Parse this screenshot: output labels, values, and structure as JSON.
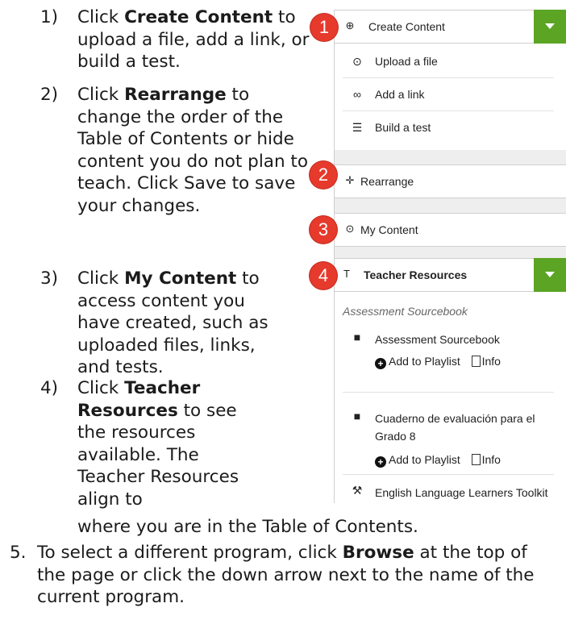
{
  "instructions": {
    "step1": {
      "num": "1)",
      "pre": "Click ",
      "bold": "Create Content",
      "post": " to upload a file, add a link, or build a test."
    },
    "step2": {
      "num": "2)",
      "pre": "Click ",
      "bold": "Rearrange",
      "post": " to change the order of the Table of Contents or hide content you do not plan to teach. Click Save to save your changes."
    },
    "step3": {
      "num": "3)",
      "pre": "Click ",
      "bold": "My Content",
      "post": " to access content you have created, such as uploaded files, links, and tests."
    },
    "step4": {
      "num": "4)",
      "pre": "Click ",
      "bold": "Teacher Resources",
      "post": " to see the resources available. The Teacher Resources align to"
    },
    "step4_cont": "where you are in the Table of Contents.",
    "step5": {
      "num": "5.",
      "pre": "To select a different program, click ",
      "bold": "Browse",
      "post": " at the top of the page or click the down arrow next to the name of the current program."
    }
  },
  "badges": [
    "1",
    "2",
    "3",
    "4"
  ],
  "panel": {
    "create_content": {
      "label": "Create Content",
      "icon": "plus-circle-icon",
      "items": [
        {
          "label": "Upload a file",
          "icon": "upload-icon"
        },
        {
          "label": "Add a link",
          "icon": "link-icon"
        },
        {
          "label": "Build a test",
          "icon": "list-icon"
        }
      ]
    },
    "rearrange": {
      "label": "Rearrange",
      "icon": "move-icon"
    },
    "my_content": {
      "label": "My Content",
      "icon": "upload-circle-icon"
    },
    "teacher_resources": {
      "label": "Teacher Resources",
      "icon": "text-icon",
      "section_title": "Assessment Sourcebook",
      "items": [
        {
          "title": "Assessment Sourcebook",
          "icon": "lock-icon",
          "add_label": "Add to Playlist",
          "info_label": "Info"
        },
        {
          "title": "Cuaderno de evaluación para el Grado 8",
          "icon": "lock-icon",
          "add_label": "Add to Playlist",
          "info_label": "Info"
        },
        {
          "title": "English Language Learners Toolkit",
          "icon": "tools-icon"
        }
      ]
    },
    "accent_color": "#5ba424",
    "badge_color": "#e63a2c"
  }
}
